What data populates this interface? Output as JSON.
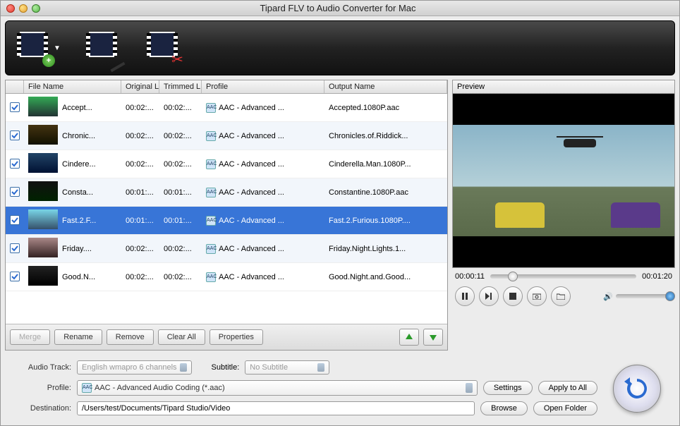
{
  "title": "Tipard FLV to Audio Converter for Mac",
  "columns": {
    "filename": "File Name",
    "original": "Original Le",
    "trimmed": "Trimmed L",
    "profile": "Profile",
    "output": "Output Name"
  },
  "rows": [
    {
      "name": "Accept...",
      "orig": "00:02:...",
      "trim": "00:02:...",
      "profile": "AAC - Advanced ...",
      "out": "Accepted.1080P.aac",
      "hue": "hue1"
    },
    {
      "name": "Chronic...",
      "orig": "00:02:...",
      "trim": "00:02:...",
      "profile": "AAC - Advanced ...",
      "out": "Chronicles.of.Riddick...",
      "hue": "hue2"
    },
    {
      "name": "Cindere...",
      "orig": "00:02:...",
      "trim": "00:02:...",
      "profile": "AAC - Advanced ...",
      "out": "Cinderella.Man.1080P...",
      "hue": "hue3"
    },
    {
      "name": "Consta...",
      "orig": "00:01:...",
      "trim": "00:01:...",
      "profile": "AAC - Advanced ...",
      "out": "Constantine.1080P.aac",
      "hue": "hue4"
    },
    {
      "name": "Fast.2.F...",
      "orig": "00:01:...",
      "trim": "00:01:...",
      "profile": "AAC - Advanced ...",
      "out": "Fast.2.Furious.1080P....",
      "hue": "hue5",
      "selected": true
    },
    {
      "name": "Friday....",
      "orig": "00:02:...",
      "trim": "00:02:...",
      "profile": "AAC - Advanced ...",
      "out": "Friday.Night.Lights.1...",
      "hue": "hue6"
    },
    {
      "name": "Good.N...",
      "orig": "00:02:...",
      "trim": "00:02:...",
      "profile": "AAC - Advanced ...",
      "out": "Good.Night.and.Good...",
      "hue": "hue7"
    }
  ],
  "buttons": {
    "merge": "Merge",
    "rename": "Rename",
    "remove": "Remove",
    "clear": "Clear All",
    "props": "Properties"
  },
  "preview": {
    "header": "Preview",
    "current": "00:00:11",
    "total": "00:01:20"
  },
  "settings": {
    "audiotrack_label": "Audio Track:",
    "audiotrack_value": "English wmapro 6 channels",
    "subtitle_label": "Subtitle:",
    "subtitle_value": "No Subtitle",
    "profile_label": "Profile:",
    "profile_value": "AAC - Advanced Audio Coding (*.aac)",
    "settings_btn": "Settings",
    "apply_btn": "Apply to All",
    "dest_label": "Destination:",
    "dest_value": "/Users/test/Documents/Tipard Studio/Video",
    "browse": "Browse",
    "open": "Open Folder"
  }
}
